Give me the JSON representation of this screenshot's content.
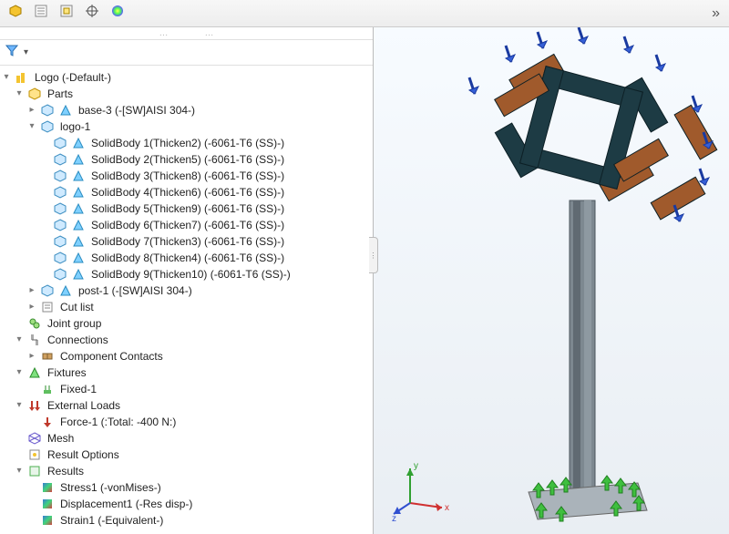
{
  "toolbar": {
    "tabs": [
      "assembly-tab",
      "props-tab",
      "config-tab",
      "appearance-tab",
      "display-tab"
    ],
    "expand_arrow": "»"
  },
  "filter": {
    "funnel": "filter-funnel-icon",
    "dropdown": "▾"
  },
  "tree": {
    "root": {
      "label": "Logo (-Default-)"
    },
    "parts": {
      "label": "Parts"
    },
    "base3": {
      "label": "base-3 (-[SW]AISI 304-)"
    },
    "logo1": {
      "label": "logo-1"
    },
    "solidbodies": [
      "SolidBody 1(Thicken2) (-6061-T6 (SS)-)",
      "SolidBody 2(Thicken5) (-6061-T6 (SS)-)",
      "SolidBody 3(Thicken8) (-6061-T6 (SS)-)",
      "SolidBody 4(Thicken6) (-6061-T6 (SS)-)",
      "SolidBody 5(Thicken9) (-6061-T6 (SS)-)",
      "SolidBody 6(Thicken7) (-6061-T6 (SS)-)",
      "SolidBody 7(Thicken3) (-6061-T6 (SS)-)",
      "SolidBody 8(Thicken4) (-6061-T6 (SS)-)",
      "SolidBody 9(Thicken10) (-6061-T6 (SS)-)"
    ],
    "post1": {
      "label": "post-1 (-[SW]AISI 304-)"
    },
    "cutlist": {
      "label": "Cut list"
    },
    "jointgroup": {
      "label": "Joint group"
    },
    "connections": {
      "label": "Connections"
    },
    "comp_contacts": {
      "label": "Component Contacts"
    },
    "fixtures": {
      "label": "Fixtures"
    },
    "fixed1": {
      "label": "Fixed-1"
    },
    "ext_loads": {
      "label": "External Loads"
    },
    "force1": {
      "label": "Force-1 (:Total: -400 N:)"
    },
    "mesh": {
      "label": "Mesh"
    },
    "result_options": {
      "label": "Result Options"
    },
    "results": {
      "label": "Results"
    },
    "stress1": {
      "label": "Stress1 (-vonMises-)"
    },
    "disp1": {
      "label": "Displacement1 (-Res disp-)"
    },
    "strain1": {
      "label": "Strain1 (-Equivalent-)"
    }
  },
  "triad": {
    "x": "x",
    "y": "y",
    "z": "z"
  },
  "colors": {
    "logo_dark": "#1d3b44",
    "logo_brown": "#a05a2c",
    "post": "#7d8890",
    "fixture_green": "#3fbf3f",
    "load_blue": "#355fd6"
  }
}
